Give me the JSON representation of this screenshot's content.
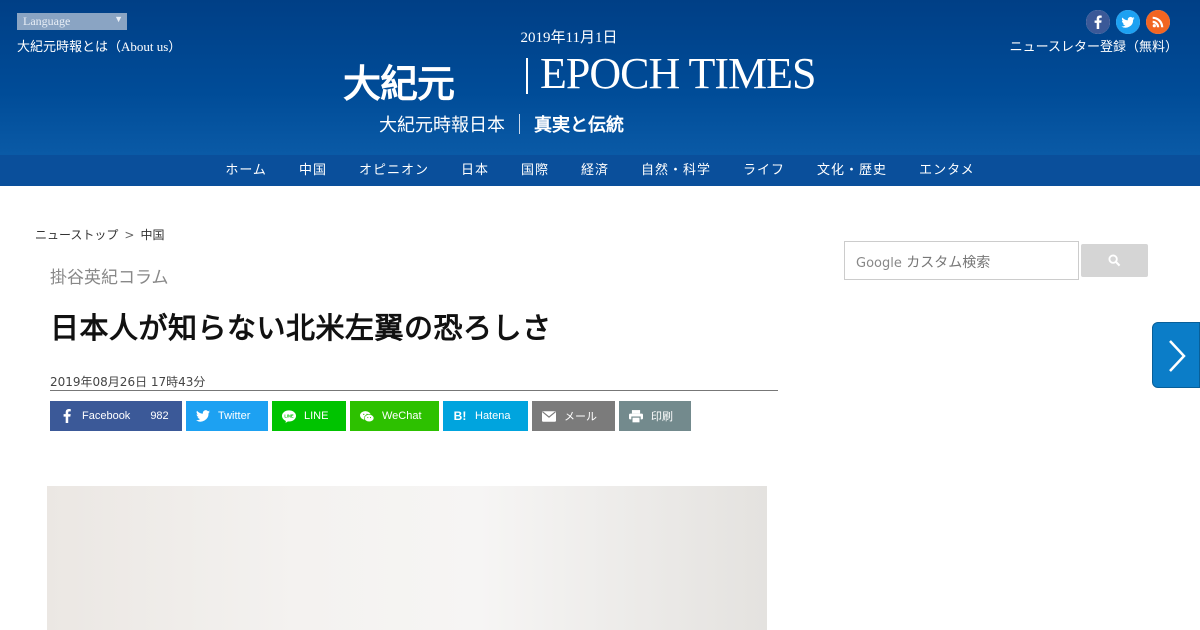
{
  "header": {
    "language_label": "Language",
    "about_link": "大紀元時報とは（About us）",
    "date": "2019年11月1日",
    "logo_cn": "大紀元",
    "logo_en": "EPOCH TIMES",
    "tagline_left": "大紀元時報日本",
    "tagline_right": "真実と伝統",
    "newsletter_link": "ニュースレター登録（無料）",
    "social": [
      "facebook-icon",
      "twitter-icon",
      "rss-icon"
    ]
  },
  "nav": {
    "items": [
      "ホーム",
      "中国",
      "オピニオン",
      "日本",
      "国際",
      "経済",
      "自然・科学",
      "ライフ",
      "文化・歴史",
      "エンタメ"
    ]
  },
  "breadcrumb": {
    "home": "ニューストップ",
    "separator": ">",
    "current": "中国"
  },
  "article": {
    "column": "掛谷英紀コラム",
    "title": "日本人が知らない北米左翼の恐ろしさ",
    "published": "2019年08月26日 17時43分"
  },
  "share": {
    "facebook": {
      "label": "Facebook",
      "count": "982",
      "color": "#3b5998"
    },
    "twitter": {
      "label": "Twitter",
      "color": "#1da1f2"
    },
    "line": {
      "label": "LINE",
      "color": "#00c300"
    },
    "wechat": {
      "label": "WeChat",
      "color": "#2dc100"
    },
    "hatena": {
      "label": "Hatena",
      "color": "#00a4de"
    },
    "mail": {
      "label": "メール",
      "color": "#7b7b7b"
    },
    "print": {
      "label": "印刷",
      "color": "#738a8d"
    }
  },
  "sidebar": {
    "search_google": "Google",
    "search_placeholder": "カスタム検索"
  }
}
